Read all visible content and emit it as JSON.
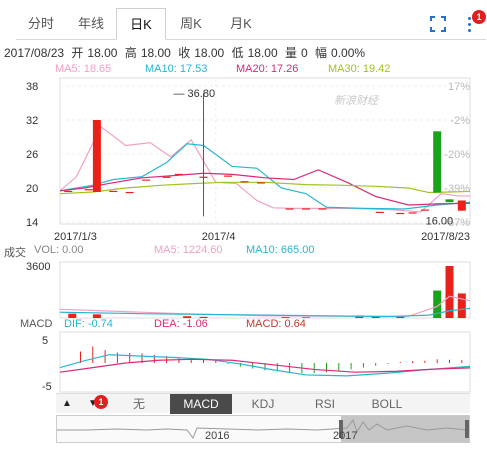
{
  "tabs": [
    {
      "label": "分时"
    },
    {
      "label": "年线"
    },
    {
      "label": "日K"
    },
    {
      "label": "周K"
    },
    {
      "label": "月K"
    }
  ],
  "active_tab": 2,
  "notification_count": "1",
  "quote": {
    "date": "2017/08/23",
    "open_label": "开",
    "open": "18.00",
    "high_label": "高",
    "high": "18.00",
    "close_label": "收",
    "close": "18.00",
    "low_label": "低",
    "low": "18.00",
    "volume_label": "量",
    "volume": "0",
    "change_label": "幅",
    "change": "0.00%"
  },
  "ma_legend": {
    "ma5": "MA5: 18.65",
    "ma10": "MA10: 17.53",
    "ma20": "MA20: 17.26",
    "ma30": "MA30: 19.42"
  },
  "volume_legend": {
    "title": "成交",
    "vol": "VOL: 0.00",
    "ma5": "MA5: 1224.60",
    "ma10": "MA10: 665.00"
  },
  "macd_legend": {
    "title": "MACD",
    "dif": "DIF: -0.74",
    "dea": "DEA: -1.06",
    "macd": "MACD: 0.64"
  },
  "watermark": "新浪财经",
  "toolbar": {
    "up_arrow": "▲",
    "down_arrow": "▼",
    "badge": "1",
    "items": [
      "无",
      "MACD",
      "KDJ",
      "RSI",
      "BOLL"
    ],
    "selected": 1
  },
  "navigator": {
    "labels": [
      "2016",
      "2017"
    ]
  },
  "colors": {
    "up": "#e8221b",
    "down": "#1aa31a",
    "ma5": "#f2a0c4",
    "ma10": "#27b6d0",
    "ma20": "#d92a78",
    "ma30": "#9fc31f",
    "accent": "#2a6fc9"
  },
  "chart_data": {
    "type": "candlestick",
    "price_axis": {
      "ticks": [
        38,
        32,
        26,
        20,
        14
      ],
      "ylim": [
        14,
        38
      ]
    },
    "percent_axis": {
      "ticks": [
        "17%",
        "-2%",
        "-20%",
        "-39%",
        "-57%"
      ]
    },
    "x_labels": [
      "2017/1/3",
      "2017/4",
      "2017/8/23"
    ],
    "annotations": {
      "max": "36.80",
      "min": "16.00"
    },
    "candles": [
      {
        "x": 0.02,
        "o": 19.5,
        "c": 19.5,
        "h": 19.5,
        "l": 19.5
      },
      {
        "x": 0.07,
        "o": 19.8,
        "c": 19.8,
        "h": 19.8,
        "l": 19.8
      },
      {
        "x": 0.09,
        "o": 19.3,
        "c": 32.0,
        "h": 32.0,
        "l": 19.3
      },
      {
        "x": 0.13,
        "o": 19.5,
        "c": 19.5,
        "h": 19.5,
        "l": 19.5
      },
      {
        "x": 0.17,
        "o": 19.3,
        "c": 19.3,
        "h": 19.3,
        "l": 19.3
      },
      {
        "x": 0.21,
        "o": 21.5,
        "c": 21.5,
        "h": 21.5,
        "l": 21.5
      },
      {
        "x": 0.26,
        "o": 22.0,
        "c": 22.0,
        "h": 22.0,
        "l": 22.0
      },
      {
        "x": 0.29,
        "o": 22.5,
        "c": 22.5,
        "h": 22.5,
        "l": 22.5
      },
      {
        "x": 0.35,
        "o": 22.0,
        "c": 22.0,
        "h": 36.8,
        "l": 15.0
      },
      {
        "x": 0.41,
        "o": 22.2,
        "c": 22.2,
        "h": 22.2,
        "l": 22.2
      },
      {
        "x": 0.45,
        "o": 21.2,
        "c": 21.2,
        "h": 21.2,
        "l": 21.2
      },
      {
        "x": 0.49,
        "o": 21.0,
        "c": 21.0,
        "h": 21.0,
        "l": 21.0
      },
      {
        "x": 0.56,
        "o": 16.4,
        "c": 16.4,
        "h": 16.4,
        "l": 16.4
      },
      {
        "x": 0.6,
        "o": 16.4,
        "c": 16.4,
        "h": 16.4,
        "l": 16.4
      },
      {
        "x": 0.64,
        "o": 16.4,
        "c": 16.4,
        "h": 16.4,
        "l": 16.4
      },
      {
        "x": 0.78,
        "o": 15.8,
        "c": 15.8,
        "h": 15.8,
        "l": 15.8
      },
      {
        "x": 0.83,
        "o": 15.6,
        "c": 15.6,
        "h": 15.6,
        "l": 15.6
      },
      {
        "x": 0.86,
        "o": 15.7,
        "c": 15.7,
        "h": 15.7,
        "l": 15.7
      },
      {
        "x": 0.89,
        "o": 16.2,
        "c": 16.2,
        "h": 16.2,
        "l": 16.2
      },
      {
        "x": 0.92,
        "o": 19.2,
        "c": 30.0,
        "h": 30.0,
        "l": 19.2,
        "up": false
      },
      {
        "x": 0.95,
        "o": 18.0,
        "c": 17.5,
        "h": 18.0,
        "l": 17.5,
        "up": false
      },
      {
        "x": 0.98,
        "o": 16.0,
        "c": 17.8,
        "h": 17.8,
        "l": 16.0
      }
    ],
    "series": [
      {
        "name": "MA5",
        "x": [
          0.0,
          0.04,
          0.1,
          0.16,
          0.22,
          0.27,
          0.32,
          0.38,
          0.43,
          0.48,
          0.52,
          0.57,
          0.62,
          0.7,
          0.8,
          0.88,
          0.93,
          0.97,
          1.0
        ],
        "values": [
          19.5,
          22.0,
          30.8,
          27.5,
          28.0,
          25.5,
          28.5,
          21.0,
          20.8,
          17.8,
          16.5,
          16.4,
          16.4,
          16.4,
          16.2,
          15.8,
          19.0,
          18.6,
          18.6
        ]
      },
      {
        "name": "MA10",
        "x": [
          0.0,
          0.08,
          0.13,
          0.2,
          0.26,
          0.31,
          0.35,
          0.42,
          0.48,
          0.54,
          0.6,
          0.65,
          0.74,
          0.84,
          0.92,
          1.0
        ],
        "values": [
          19.5,
          20.5,
          21.5,
          22.0,
          24.5,
          27.8,
          27.5,
          23.8,
          23.5,
          20.0,
          19.0,
          16.6,
          16.4,
          16.3,
          17.0,
          17.5
        ]
      },
      {
        "name": "MA20",
        "x": [
          0.0,
          0.06,
          0.12,
          0.2,
          0.28,
          0.35,
          0.42,
          0.5,
          0.57,
          0.63,
          0.7,
          0.77,
          0.85,
          0.92,
          1.0
        ],
        "values": [
          19.5,
          20.0,
          20.8,
          21.8,
          22.2,
          22.6,
          22.4,
          21.8,
          21.5,
          23.2,
          21.0,
          18.5,
          17.0,
          17.2,
          17.3
        ]
      },
      {
        "name": "MA30",
        "x": [
          0.0,
          0.08,
          0.16,
          0.25,
          0.33,
          0.4,
          0.5,
          0.6,
          0.68,
          0.77,
          0.85,
          0.9,
          0.95,
          1.0
        ],
        "values": [
          19.0,
          19.3,
          20.0,
          20.5,
          20.8,
          21.0,
          21.0,
          20.6,
          20.5,
          20.3,
          20.0,
          19.2,
          19.3,
          19.4
        ]
      }
    ],
    "volume": {
      "ymax": 3600,
      "bars": [
        {
          "x": 0.03,
          "v": 300,
          "up": true
        },
        {
          "x": 0.09,
          "v": 250,
          "up": true
        },
        {
          "x": 0.31,
          "v": 120,
          "up": true
        },
        {
          "x": 0.35,
          "v": 80,
          "up": true
        },
        {
          "x": 0.55,
          "v": 60,
          "up": true
        },
        {
          "x": 0.6,
          "v": 50,
          "up": true
        },
        {
          "x": 0.73,
          "v": 180,
          "up": true
        },
        {
          "x": 0.77,
          "v": 120,
          "up": true
        },
        {
          "x": 0.83,
          "v": 140,
          "up": true
        },
        {
          "x": 0.92,
          "v": 1900,
          "up": false
        },
        {
          "x": 0.95,
          "v": 3600,
          "up": true
        },
        {
          "x": 0.98,
          "v": 1700,
          "up": true
        }
      ],
      "ma5_x": [
        0.0,
        0.1,
        0.3,
        0.5,
        0.7,
        0.85,
        0.92,
        0.95,
        1.0
      ],
      "ma5_values": [
        600,
        500,
        300,
        150,
        120,
        120,
        800,
        1500,
        1200
      ],
      "ma10_x": [
        0.0,
        0.2,
        0.5,
        0.8,
        0.9,
        0.95,
        1.0
      ],
      "ma10_values": [
        400,
        300,
        200,
        100,
        200,
        500,
        665
      ]
    },
    "macd": {
      "ylim": [
        -5,
        5
      ],
      "ticks": [
        5,
        -5
      ],
      "bars": [
        {
          "x": 0.05,
          "v": 2.5
        },
        {
          "x": 0.08,
          "v": 3.6
        },
        {
          "x": 0.11,
          "v": 2.8
        },
        {
          "x": 0.14,
          "v": 2.3
        },
        {
          "x": 0.17,
          "v": 2.2
        },
        {
          "x": 0.2,
          "v": 2.1
        },
        {
          "x": 0.23,
          "v": 1.8
        },
        {
          "x": 0.26,
          "v": 1.5
        },
        {
          "x": 0.29,
          "v": 1.2
        },
        {
          "x": 0.32,
          "v": 1.0
        },
        {
          "x": 0.35,
          "v": 0.8
        },
        {
          "x": 0.38,
          "v": 0.5
        },
        {
          "x": 0.41,
          "v": -0.2
        },
        {
          "x": 0.44,
          "v": -0.8
        },
        {
          "x": 0.47,
          "v": -1.2
        },
        {
          "x": 0.5,
          "v": -1.6
        },
        {
          "x": 0.53,
          "v": -1.8
        },
        {
          "x": 0.56,
          "v": -2.0
        },
        {
          "x": 0.59,
          "v": -2.2
        },
        {
          "x": 0.62,
          "v": -2.2
        },
        {
          "x": 0.65,
          "v": -2.0
        },
        {
          "x": 0.68,
          "v": -1.8
        },
        {
          "x": 0.71,
          "v": -1.4
        },
        {
          "x": 0.74,
          "v": -1.0
        },
        {
          "x": 0.77,
          "v": -0.6
        },
        {
          "x": 0.8,
          "v": -0.2
        },
        {
          "x": 0.83,
          "v": 0.2
        },
        {
          "x": 0.86,
          "v": 0.4
        },
        {
          "x": 0.89,
          "v": 0.5
        },
        {
          "x": 0.92,
          "v": 0.8
        },
        {
          "x": 0.95,
          "v": 0.7
        },
        {
          "x": 0.98,
          "v": 0.64
        }
      ],
      "dif_x": [
        0.0,
        0.06,
        0.12,
        0.2,
        0.28,
        0.36,
        0.44,
        0.52,
        0.6,
        0.7,
        0.8,
        0.9,
        1.0
      ],
      "dif_values": [
        -1.0,
        0.5,
        1.8,
        1.5,
        1.2,
        0.8,
        -0.2,
        -1.5,
        -2.6,
        -2.8,
        -2.2,
        -1.4,
        -0.74
      ],
      "dea_x": [
        0.0,
        0.08,
        0.16,
        0.24,
        0.32,
        0.42,
        0.52,
        0.62,
        0.72,
        0.82,
        0.92,
        1.0
      ],
      "dea_values": [
        -2.0,
        -1.0,
        0.0,
        0.6,
        0.8,
        0.6,
        -0.4,
        -1.4,
        -2.0,
        -1.8,
        -1.3,
        -1.06
      ]
    }
  }
}
